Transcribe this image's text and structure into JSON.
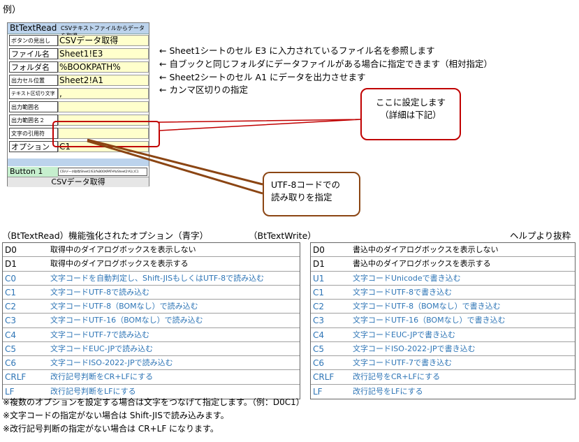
{
  "example_label": "例）",
  "config": {
    "app_name": "BtTextRead",
    "header_desc": "CSVテキストファイルからデータを取得",
    "rows": [
      {
        "label": "ボタンの見出し",
        "value": "CSVデータ取得"
      },
      {
        "label": "ファイル名",
        "value": "Sheet1!E3"
      },
      {
        "label": "フォルダ名",
        "value": "%BOOKPATH%"
      },
      {
        "label": "出力セル位置",
        "value": "Sheet2!A1"
      },
      {
        "label": "テキスト区切り文字",
        "value": ","
      },
      {
        "label": "出力範囲名",
        "value": ""
      },
      {
        "label": "出力範囲名２",
        "value": ""
      },
      {
        "label": "文字の引用符",
        "value": ""
      },
      {
        "label": "オプション",
        "value": "C1"
      }
    ],
    "button1_label": "Button 1",
    "button1_field": "CSVデータ取得/Sheet1!E3/%BOOKPATH%/Sheet2!A1/,/C1",
    "button_caption": "CSVデータ取得"
  },
  "notes": [
    "← Sheet1シートのセル E3 に入力されているファイル名を参照します",
    "← 自ブックと同じフォルダにデータファイルがある場合に指定できます（相対指定）",
    "← Sheet2シートのセル A1 にデータを出力させます",
    "← カンマ区切りの指定"
  ],
  "callout_setting": {
    "line1": "ここに設定します",
    "line2": "（詳細は下記）"
  },
  "callout_utf8": {
    "line1": "UTF-8コードでの",
    "line2": "読み取りを指定"
  },
  "read_title": "（BtTextRead）機能強化されたオプション（青字）",
  "write_title": "（BtTextWrite）",
  "help_note": "ヘルプより抜粋",
  "read_options": [
    {
      "code": "D0",
      "desc": "取得中のダイアログボックスを表示しない",
      "blue": false
    },
    {
      "code": "D1",
      "desc": "取得中のダイアログボックスを表示する",
      "blue": false
    },
    {
      "code": "C0",
      "desc": "文字コードを自動判定し、Shift-JISもしくはUTF-8で読み込む",
      "blue": true
    },
    {
      "code": "C1",
      "desc": "文字コードUTF-8で読み込む",
      "blue": true
    },
    {
      "code": "C2",
      "desc": "文字コードUTF-8（BOMなし）で読み込む",
      "blue": true
    },
    {
      "code": "C3",
      "desc": "文字コードUTF-16（BOMなし）で読み込む",
      "blue": true
    },
    {
      "code": "C4",
      "desc": "文字コードUTF-7で読み込む",
      "blue": true
    },
    {
      "code": "C5",
      "desc": "文字コードEUC-JPで読み込む",
      "blue": true
    },
    {
      "code": "C6",
      "desc": "文字コードISO-2022-JPで読み込む",
      "blue": true
    },
    {
      "code": "CRLF",
      "desc": "改行記号判断をCR+LFにする",
      "blue": true
    },
    {
      "code": "LF",
      "desc": "改行記号判断をLFにする",
      "blue": true
    }
  ],
  "write_options": [
    {
      "code": "D0",
      "desc": "書込中のダイアログボックスを表示しない",
      "blue": false
    },
    {
      "code": "D1",
      "desc": "書込中のダイアログボックスを表示する",
      "blue": false
    },
    {
      "code": "U1",
      "desc": "文字コードUnicodeで書き込む",
      "blue": true
    },
    {
      "code": "C1",
      "desc": "文字コードUTF-8で書き込む",
      "blue": true
    },
    {
      "code": "C2",
      "desc": "文字コードUTF-8（BOMなし）で書き込む",
      "blue": true
    },
    {
      "code": "C3",
      "desc": "文字コードUTF-16（BOMなし）で書き込む",
      "blue": true
    },
    {
      "code": "C4",
      "desc": "文字コードEUC-JPで書き込む",
      "blue": true
    },
    {
      "code": "C5",
      "desc": "文字コードISO-2022-JPで書き込む",
      "blue": true
    },
    {
      "code": "C6",
      "desc": "文字コードUTF-7で書き込む",
      "blue": true
    },
    {
      "code": "CRLF",
      "desc": "改行記号をCR+LFにする",
      "blue": true
    },
    {
      "code": "LF",
      "desc": "改行記号をLFにする",
      "blue": true
    }
  ],
  "footnotes": [
    "※複数のオプションを設定する場合は文字をつなげて指定します。（例：D0C1）",
    "※文字コードの指定がない場合は Shift-JISで読み込みます。",
    "※改行記号判断の指定がない場合は CR+LF になります。"
  ],
  "colors": {
    "blue_text": "#2e75b6",
    "callout_border": "#c00000",
    "connector": "#8b4513",
    "header_bg": "#bcd3ec",
    "value_bg": "#ffffcc"
  }
}
